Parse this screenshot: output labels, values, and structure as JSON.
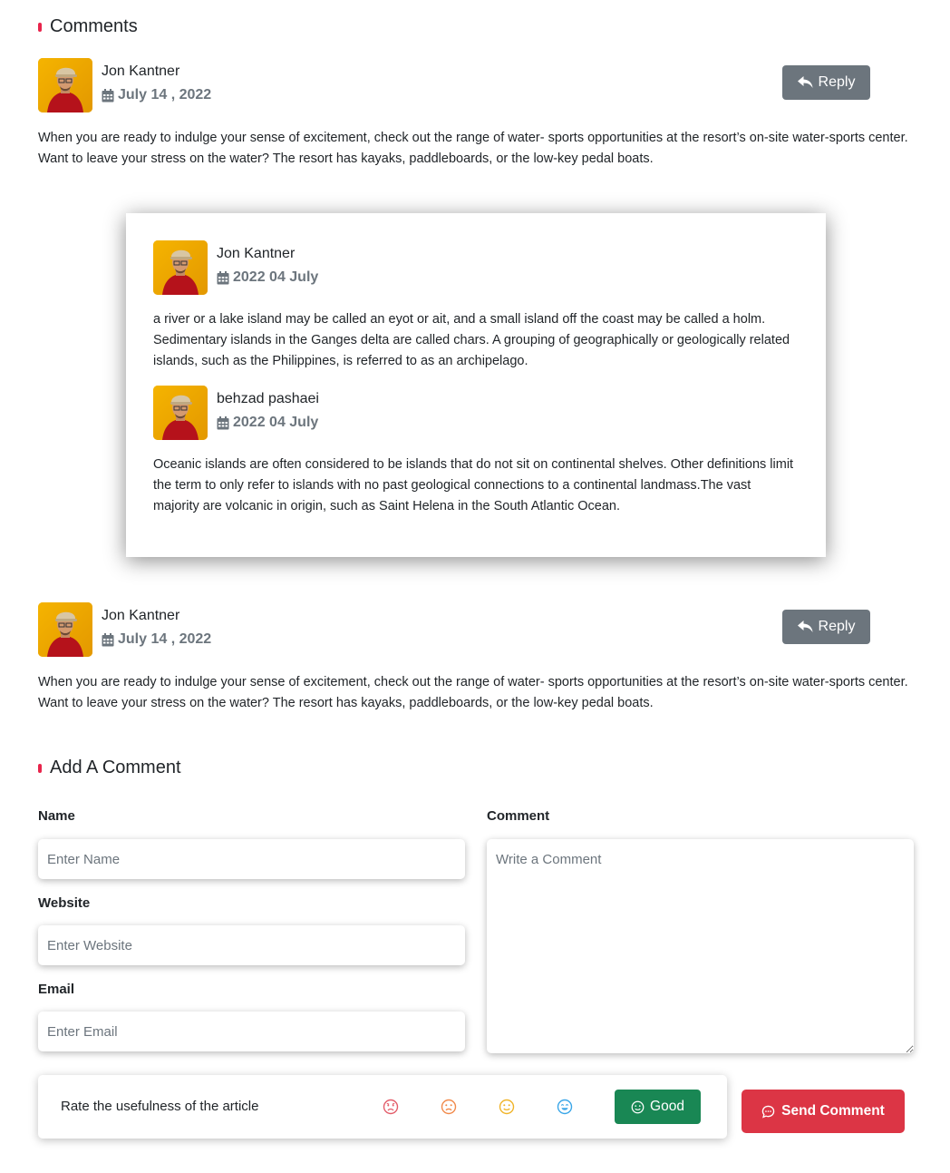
{
  "comments_section": {
    "title": "Comments"
  },
  "comments": [
    {
      "author": "Jon Kantner",
      "date": "July 14 , 2022",
      "reply_label": "Reply",
      "text": "When you are ready to indulge your sense of excitement, check out the range of water- sports opportunities at the resort’s on-site water-sports center. Want to leave your stress on the water? The resort has kayaks, paddleboards, or the low-key pedal boats.",
      "replies": [
        {
          "author": "Jon Kantner",
          "date": "2022 04 July",
          "text": "a river or a lake island may be called an eyot or ait, and a small island off the coast may be called a holm. Sedimentary islands in the Ganges delta are called chars. A grouping of geographically or geologically related islands, such as the Philippines, is referred to as an archipelago."
        },
        {
          "author": "behzad pashaei",
          "date": "2022 04 July",
          "text": "Oceanic islands are often considered to be islands that do not sit on continental shelves. Other definitions limit the term to only refer to islands with no past geological connections to a continental landmass.The vast majority are volcanic in origin, such as Saint Helena in the South Atlantic Ocean."
        }
      ]
    },
    {
      "author": "Jon Kantner",
      "date": "July 14 , 2022",
      "reply_label": "Reply",
      "text": "When you are ready to indulge your sense of excitement, check out the range of water- sports opportunities at the resort’s on-site water-sports center. Want to leave your stress on the water? The resort has kayaks, paddleboards, or the low-key pedal boats."
    }
  ],
  "add_comment": {
    "title": "Add A Comment",
    "name_label": "Name",
    "name_placeholder": "Enter Name",
    "website_label": "Website",
    "website_placeholder": "Enter Website",
    "email_label": "Email",
    "email_placeholder": "Enter Email",
    "comment_label": "Comment",
    "comment_placeholder": "Write a Comment",
    "rating_label": "Rate the usefulness of the article",
    "rating_options": [
      "angry-face-icon",
      "sad-face-icon",
      "neutral-face-icon",
      "smile-face-icon"
    ],
    "rating_selected": "Good",
    "send_label": "Send Comment"
  },
  "colors": {
    "accent": "#e8254c",
    "reply_button": "#6c757d",
    "good_button": "#198754",
    "send_button": "#dc3545",
    "emoji_angry": "#e35d6a",
    "emoji_sad": "#f18a4b",
    "emoji_neutral": "#f0b429",
    "emoji_smile": "#3aa6e8"
  }
}
